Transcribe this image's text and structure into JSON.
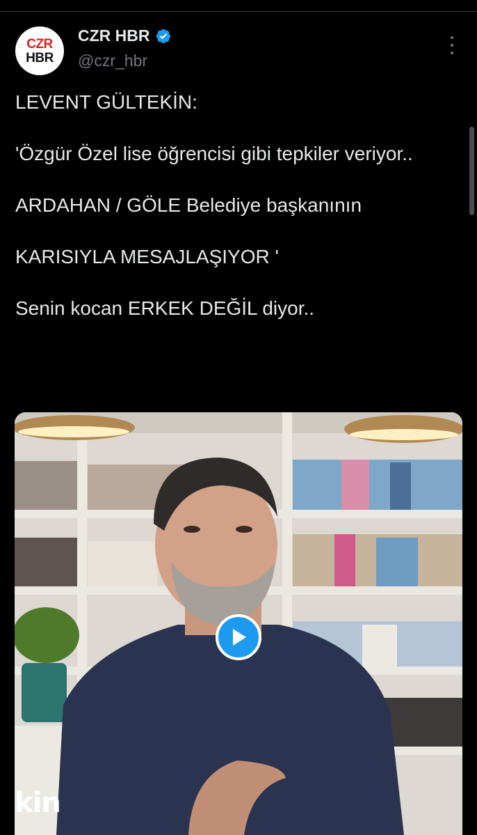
{
  "account": {
    "avatar_line1": "CZR",
    "avatar_line2": "HBR",
    "display_name": "CZR HBR",
    "handle": "@czr_hbr",
    "verified_icon": "verified-badge-icon",
    "more_icon": "more-vertical-icon"
  },
  "tweet": {
    "text": "LEVENT GÜLTEKİN:\n\n'Özgür Özel lise öğrencisi gibi tepkiler veriyor..\n\nARDAHAN / GÖLE Belediye başkanının\n\nKARISIYLA MESAJLAŞIYOR '\n\nSenin kocan ERKEK DEĞİL diyor.."
  },
  "media": {
    "type": "video",
    "play_icon": "play-icon",
    "overlay_caption": "kin"
  },
  "colors": {
    "background": "#000000",
    "text": "#e7e9ea",
    "secondary_text": "#71767b",
    "accent": "#1d9bf0",
    "avatar_red": "#e0201a"
  }
}
